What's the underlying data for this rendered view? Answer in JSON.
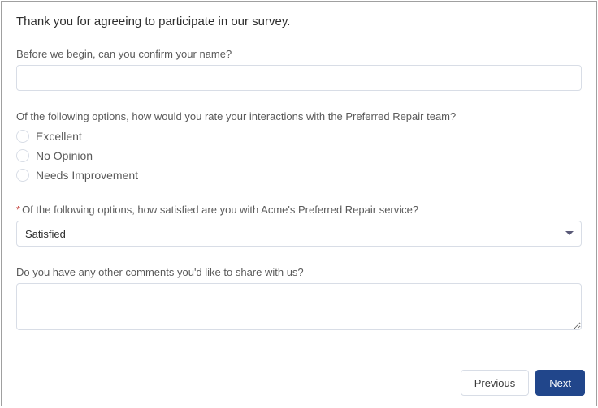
{
  "title": "Thank you for agreeing to participate in our survey.",
  "name_field": {
    "label": "Before we begin, can you confirm your name?",
    "value": ""
  },
  "rating_field": {
    "label": "Of the following options, how would you rate your interactions with the Preferred Repair team?",
    "options": [
      "Excellent",
      "No Opinion",
      "Needs Improvement"
    ]
  },
  "satisfaction_field": {
    "required_mark": "*",
    "label": "Of the following options, how satisfied are you with Acme's Preferred Repair service?",
    "value": "Satisfied"
  },
  "comments_field": {
    "label": "Do you have any other comments you'd like to share with us?",
    "value": ""
  },
  "buttons": {
    "previous": "Previous",
    "next": "Next"
  }
}
